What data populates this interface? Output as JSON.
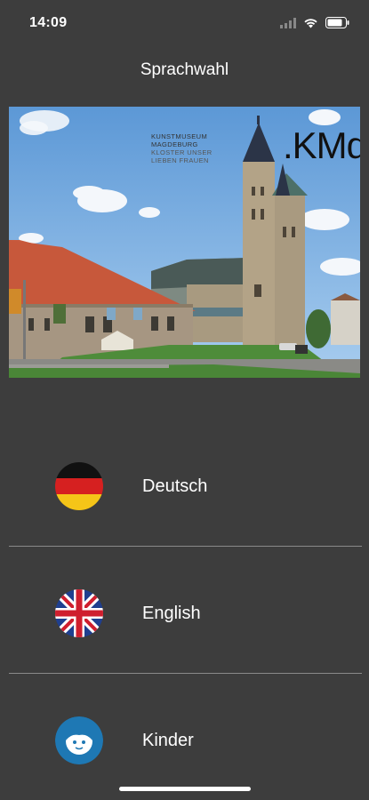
{
  "status": {
    "time": "14:09"
  },
  "header": {
    "title": "Sprachwahl"
  },
  "hero": {
    "museum_line1": "KUNSTMUSEUM",
    "museum_line2": "MAGDEBURG",
    "museum_line3": "KLOSTER UNSER",
    "museum_line4": "LIEBEN FRAUEN",
    "logo": ".KMd"
  },
  "languages": [
    {
      "label": "Deutsch",
      "icon": "german-flag-icon"
    },
    {
      "label": "English",
      "icon": "uk-flag-icon"
    },
    {
      "label": "Kinder",
      "icon": "kids-face-icon"
    }
  ],
  "colors": {
    "background": "#3d3d3d",
    "divider": "#8a8a8a",
    "kids_blue": "#1e78b4"
  }
}
